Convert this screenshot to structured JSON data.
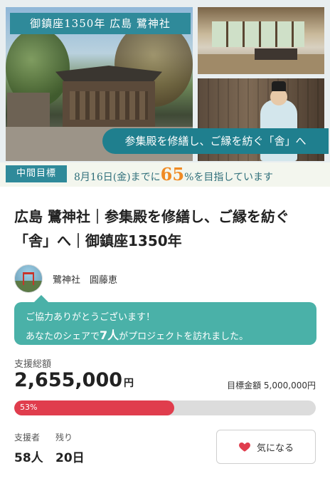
{
  "hero": {
    "title_banner": "御鎮座1350年 広島 鷺神社",
    "slogan": "参集殿を修繕し、ご縁を紡ぐ「舎」へ",
    "goal_tag": "中間目標",
    "goal_prefix": "8月16日(金)までに",
    "goal_percent": "65",
    "goal_suffix": "%を目指しています"
  },
  "project": {
    "title": "広島 鷺神社｜参集殿を修繕し、ご縁を紡ぐ「舎」へ｜御鎮座1350年",
    "owner_name": "鷺神社　圓藤恵"
  },
  "share_message": {
    "line1": "ご協力ありがとうございます！",
    "line2_prefix": "あなたのシェアで",
    "line2_count": "7人",
    "line2_suffix": "がプロジェクトを訪れました。"
  },
  "funding": {
    "label": "支援総額",
    "amount": "2,655,000",
    "unit": "円",
    "target_label": "目標金額",
    "target_amount": "5,000,000円",
    "progress_text": "53%",
    "progress_fraction": 0.53
  },
  "stats": {
    "supporters_label": "支援者",
    "supporters_value": "58人",
    "remaining_label": "残り",
    "remaining_value": "20日"
  },
  "favorite": {
    "label": "気になる",
    "icon": "heart-icon",
    "color": "#e03d4d"
  },
  "colors": {
    "teal": "#2f8a9a",
    "bubble": "#4ab1a8",
    "progress": "#e03d4d",
    "goal_percent": "#f08a23"
  }
}
